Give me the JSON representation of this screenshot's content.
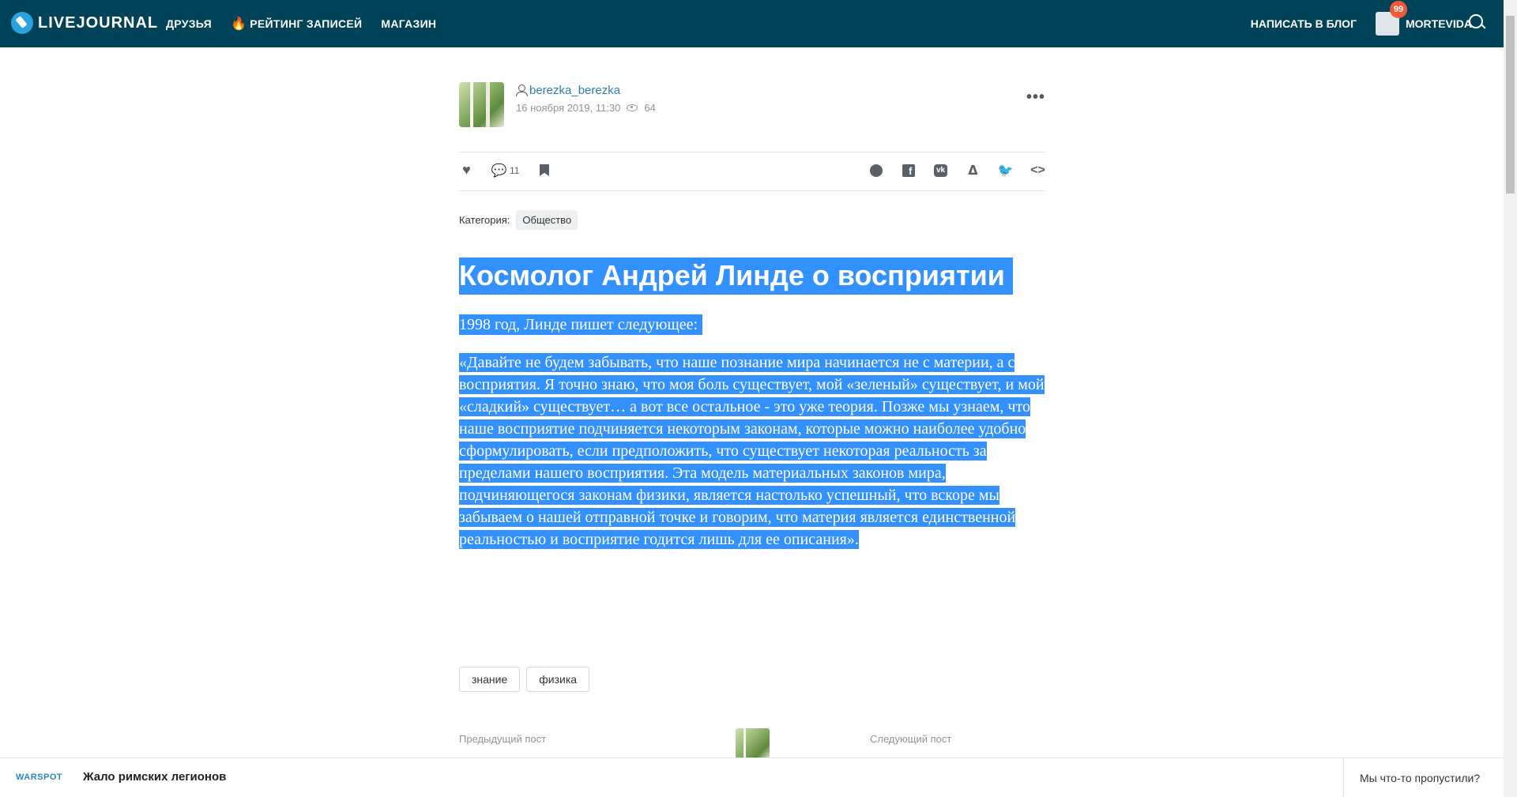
{
  "header": {
    "logo_text": "LIVEJOURNAL",
    "nav": [
      "ДРУЗЬЯ",
      "РЕЙТИНГ ЗАПИСЕЙ",
      "МАГАЗИН"
    ],
    "write_label": "НАПИСАТЬ В БЛОГ",
    "user_name": "MORTEVIDA",
    "notification_count": "99",
    "colors": {
      "bar": "#004359",
      "badge": "#f15a38"
    }
  },
  "post": {
    "author": "berezka_berezka",
    "date": "16 ноября 2019, 11:30",
    "views": "64",
    "comments": "11",
    "category_label": "Категория:",
    "category": "Общество",
    "title": "Космолог Андрей Линде о восприятии",
    "lead": "1998 год, Линде пишет следующее:",
    "quote": "«Давайте не будем забывать, что наше познание мира начинается не с материи, а с восприятия. Я точно знаю, что моя боль существует, мой «зеленый» существует, и мой «сладкий» существует… а вот все остальное - это уже теория. Позже мы узнаем, что наше восприятие подчиняется некоторым законам, которые можно наиболее удобно сформулировать, если предположить, что существует некоторая реальность за пределами нашего восприятия. Эта модель материальных законов мира, подчиняющегося законам физики, является настолько успешный, что вскоре мы забываем о нашей отправной точке и говорим, что материя является единственной реальностью и восприятие годится лишь для ее описания».",
    "tags": [
      "знание",
      "физика"
    ],
    "selection_color": "#3391ff"
  },
  "postnav": {
    "prev_label": "Предыдущий пост",
    "next_label": "Следующий пост"
  },
  "bottom": {
    "source": "WARSPOT",
    "title": "Жало римских легионов",
    "missed": "Мы что-то пропустили?"
  }
}
